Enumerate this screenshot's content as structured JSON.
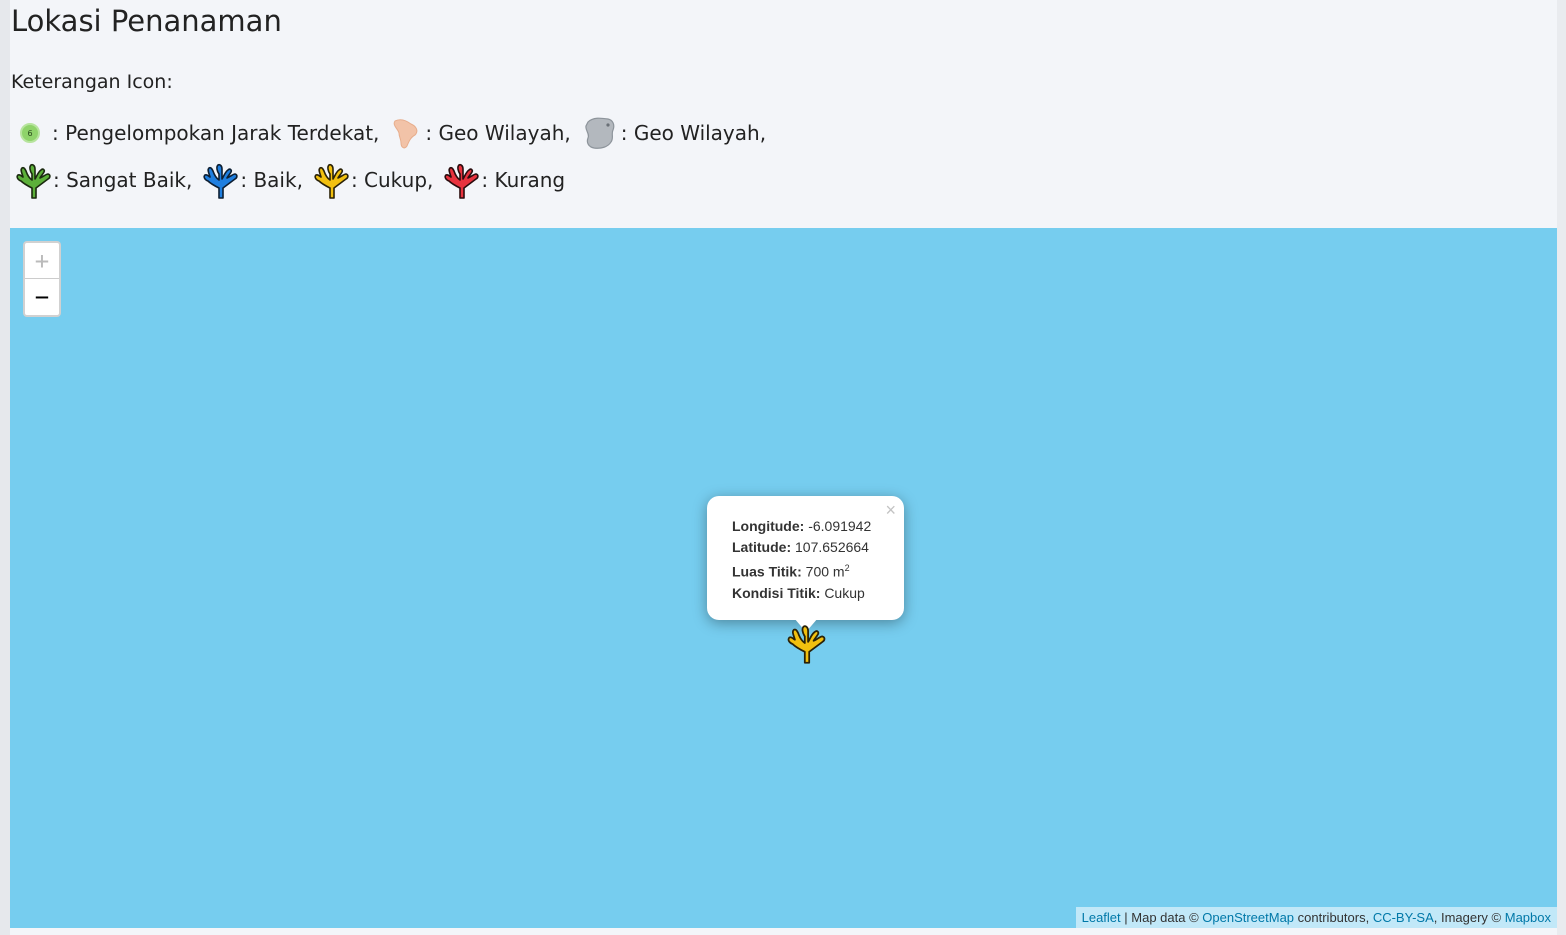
{
  "page": {
    "title": "Lokasi Penanaman",
    "legend_heading": "Keterangan Icon:"
  },
  "legend": {
    "cluster_count": "6",
    "cluster_label": ": Pengelompokan Jarak Terdekat,",
    "geo_label_1": ": Geo Wilayah,",
    "geo_label_2": ": Geo Wilayah,",
    "very_good_label": ": Sangat Baik,",
    "good_label": ": Baik,",
    "fair_label": ": Cukup,",
    "poor_label": ": Kurang"
  },
  "colors": {
    "very_good": "#5cb03a",
    "good": "#1f7fe0",
    "fair": "#f2c00f",
    "poor": "#e8323e",
    "water": "#76cdef"
  },
  "icons": {
    "cluster": "cluster-dot-icon",
    "geo_1": "region-shape-peach-icon",
    "geo_2": "region-shape-gray-icon",
    "coral": "coral-icon"
  },
  "map": {
    "zoom_in": "+",
    "zoom_out": "−",
    "popup": {
      "close": "×",
      "longitude_label": "Longitude:",
      "longitude_value": "-6.091942",
      "latitude_label": "Latitude:",
      "latitude_value": "107.652664",
      "area_label": "Luas Titik:",
      "area_value": "700 m",
      "area_unit_sup": "2",
      "condition_label": "Kondisi Titik:",
      "condition_value": "Cukup"
    },
    "attribution": {
      "leaflet": "Leaflet",
      "sep": " | Map data © ",
      "osm": "OpenStreetMap",
      "contributors": " contributors, ",
      "license": "CC-BY-SA",
      "imagery": ", Imagery © ",
      "mapbox": "Mapbox"
    }
  }
}
